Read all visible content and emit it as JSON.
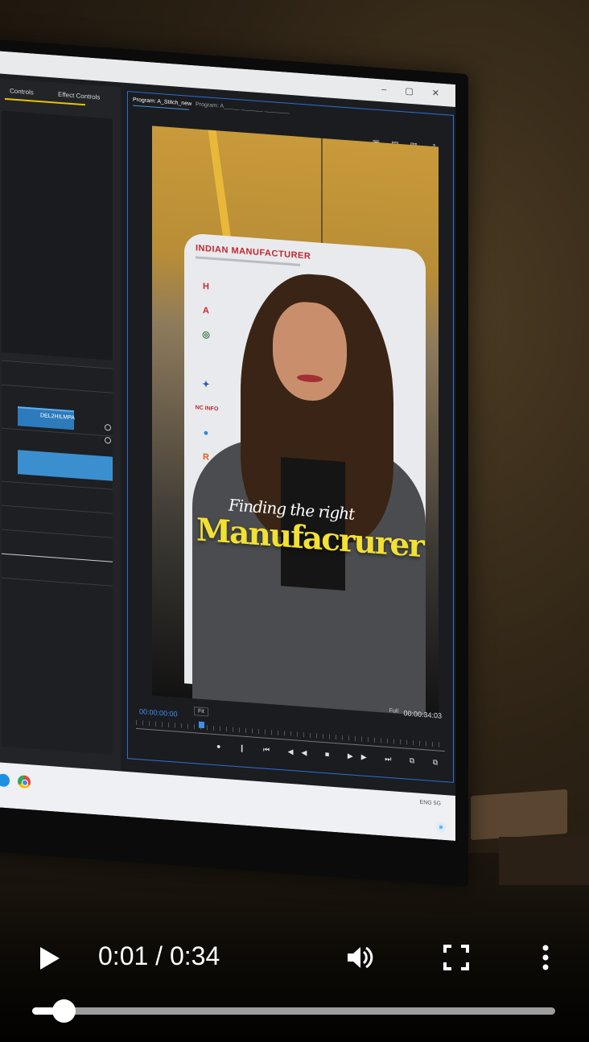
{
  "editor": {
    "left_tab_1": "Controls",
    "left_tab_2": "Effect Controls",
    "clip_label": "DEL2HILMPA",
    "program_tab": "Program: A_Stitch_new",
    "program_tab_2": "Program: A_____ _______ ________",
    "timecode_left": "00:00:00:00",
    "timecode_right": "00:00:34:03",
    "fit_option": "Fit",
    "resolution_option": "Full",
    "taskbar_tray": "ENG  5G"
  },
  "video_frame": {
    "banner_title": "INDIAN MANUFACTURER",
    "caption_script": "Finding the right",
    "caption_main": "Manufacrurer",
    "logo_letters": [
      "H",
      "A",
      "R",
      "A"
    ],
    "logo_text": "NC INFO"
  },
  "player": {
    "current_time": "0:01",
    "separator": " / ",
    "duration": "0:34",
    "progress": 0.06
  }
}
